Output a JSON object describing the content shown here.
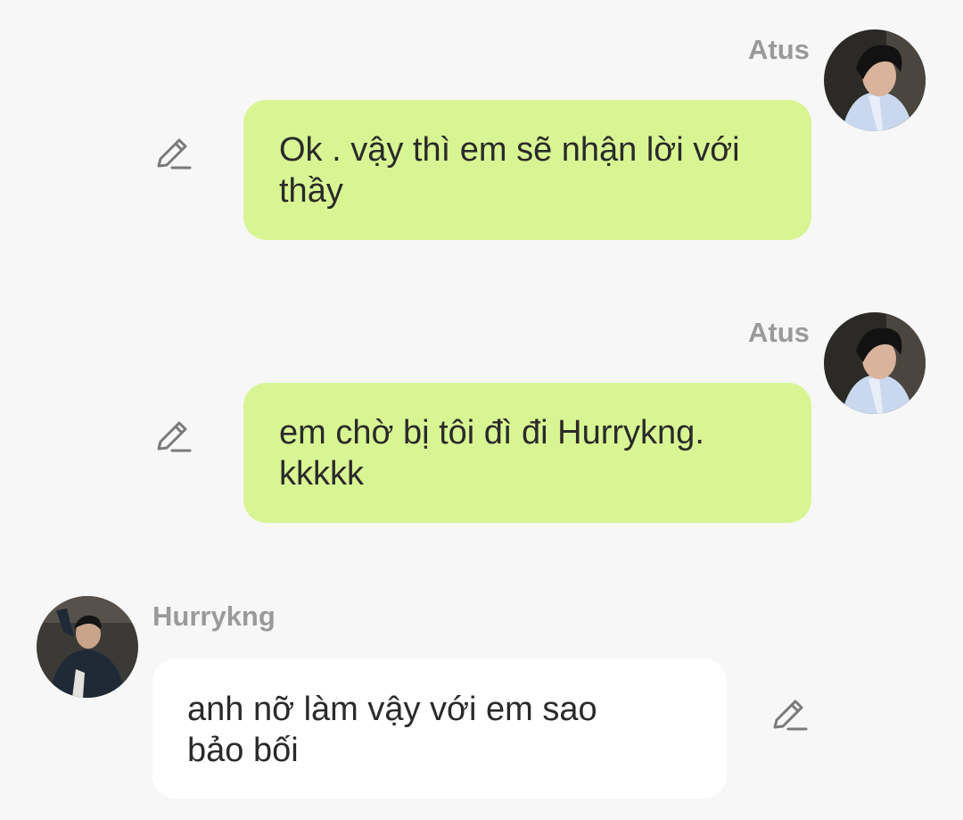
{
  "colors": {
    "background": "#f7f7f7",
    "outgoing_bubble": "#d8f593",
    "incoming_bubble": "#ffffff",
    "sender_name": "#9a9a9a",
    "message_text": "#2a2a2a",
    "icon": "#7a7a7a"
  },
  "messages": [
    {
      "direction": "outgoing",
      "sender": "Atus",
      "text_lines": [
        "Ok . vậy thì em sẽ nhận lời với",
        "thầy"
      ],
      "avatar_icon": "user-photo-atus",
      "action_icon": "edit-pencil-icon"
    },
    {
      "direction": "outgoing",
      "sender": "Atus",
      "text_lines": [
        "em chờ bị tôi đì đi Hurrykng.",
        "kkkkk"
      ],
      "avatar_icon": "user-photo-atus",
      "action_icon": "edit-pencil-icon"
    },
    {
      "direction": "incoming",
      "sender": "Hurrykng",
      "text_lines": [
        "anh nỡ làm vậy với em sao",
        "bảo bối"
      ],
      "avatar_icon": "user-photo-hurrykng",
      "action_icon": "edit-pencil-icon"
    }
  ]
}
